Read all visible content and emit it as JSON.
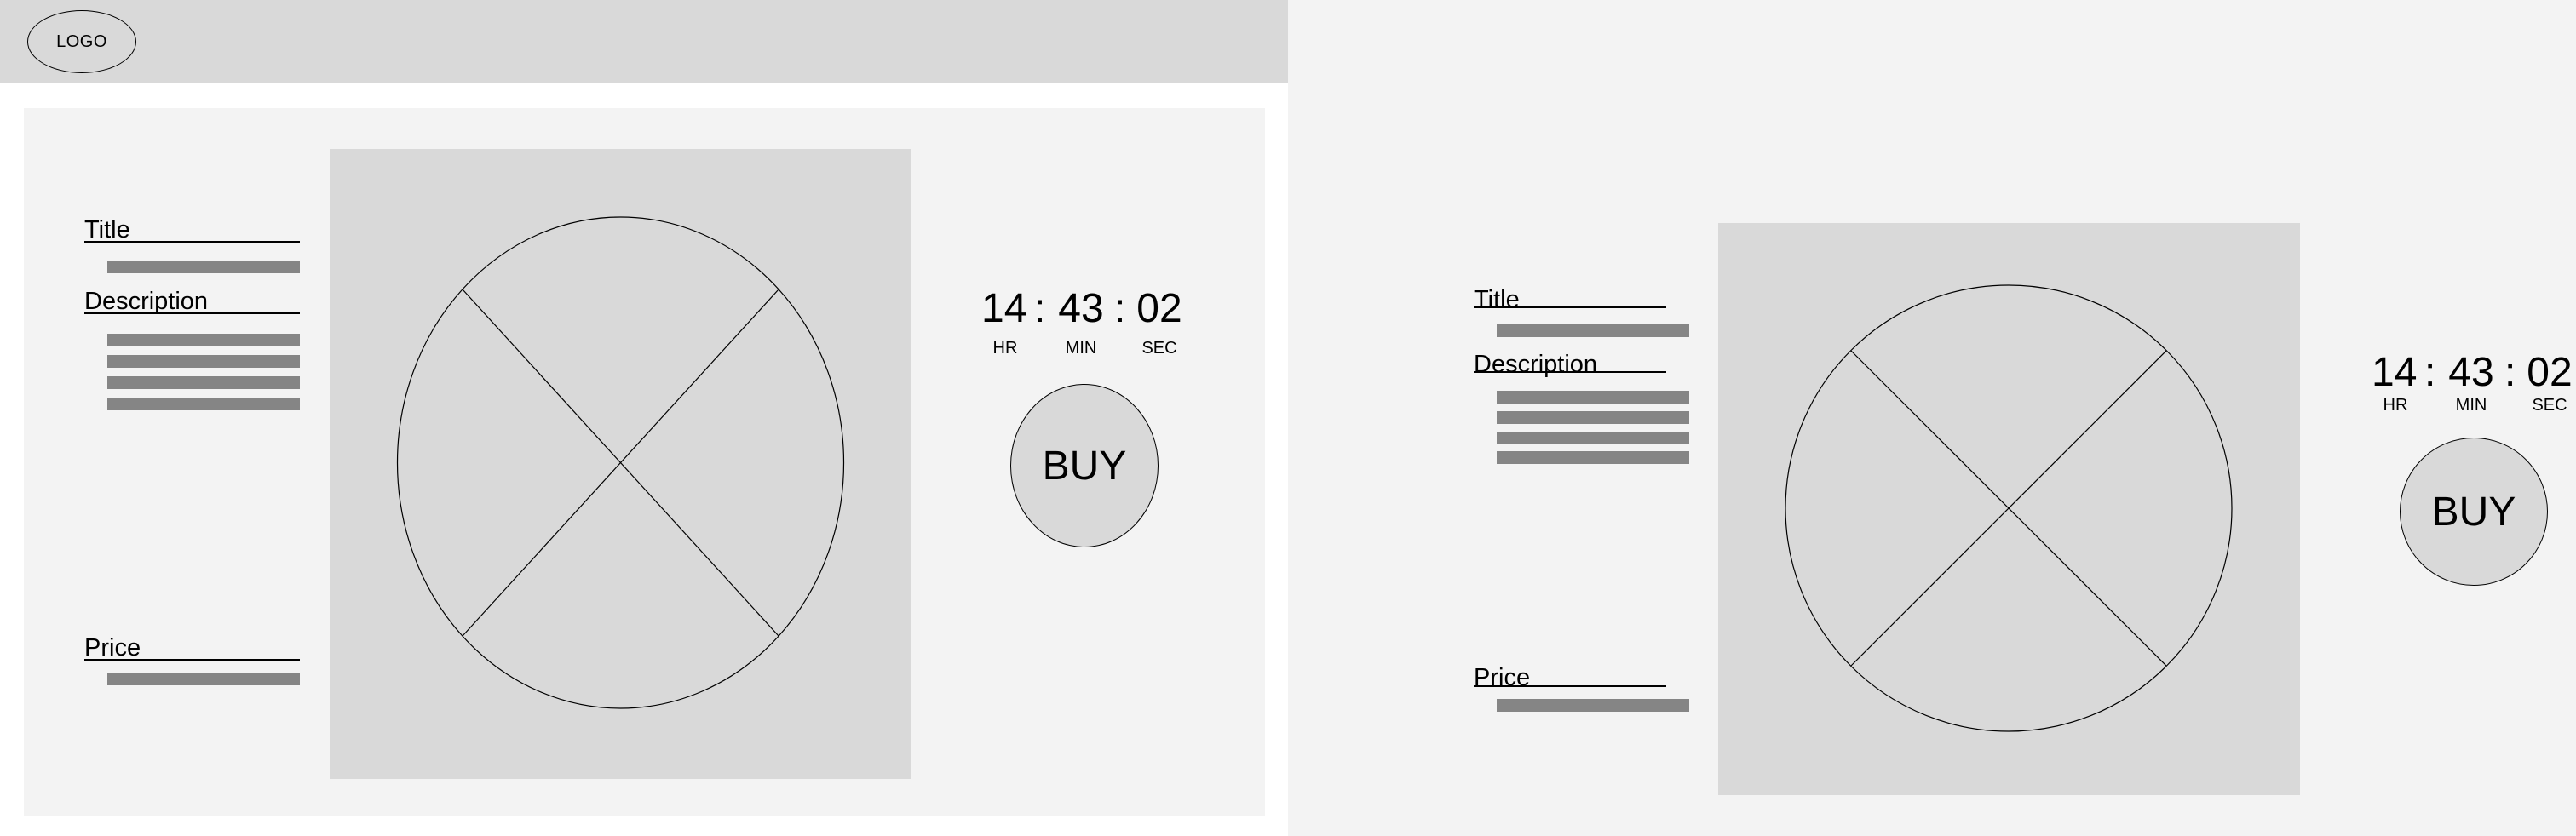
{
  "header": {
    "logo_label": "LOGO"
  },
  "product": {
    "title_label": "Title",
    "description_label": "Description",
    "price_label": "Price"
  },
  "countdown": {
    "hours": "14",
    "minutes": "43",
    "seconds": "02",
    "separator": ":",
    "hours_unit": "HR",
    "minutes_unit": "MIN",
    "seconds_unit": "SEC"
  },
  "buy_button": {
    "label": "BUY"
  },
  "icons": {
    "image_placeholder": "image-placeholder-icon"
  },
  "colors": {
    "header_bg": "#d9d9d9",
    "panel_bg": "#f3f3f3",
    "placeholder_bg": "#d9d9d9",
    "text_bar": "#858585"
  }
}
